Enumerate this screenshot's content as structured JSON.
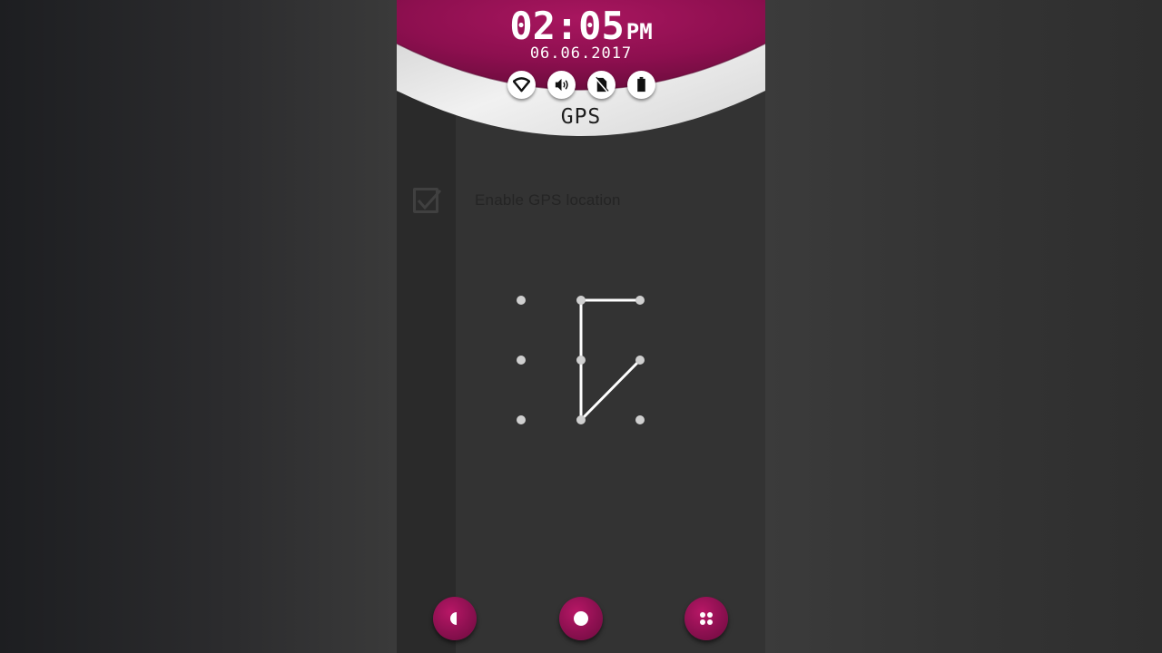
{
  "lockscreen": {
    "clock": {
      "time": "02:05",
      "ampm": "PM",
      "date": "06.06.2017"
    },
    "status_icons": [
      "wifi-icon",
      "volume-icon",
      "no-sim-icon",
      "battery-icon"
    ],
    "title": "GPS",
    "colors": {
      "accent": "#9c1258",
      "header_silver": "#e6e6e6",
      "background": "#333333"
    }
  },
  "settings": {
    "gps_option_label": "Enable GPS location",
    "gps_option_checked": true
  },
  "pattern": {
    "grid": "3x3",
    "path": [
      3,
      2,
      5,
      8,
      6
    ]
  },
  "navigation": {
    "buttons": [
      "back-icon",
      "home-icon",
      "apps-icon"
    ]
  }
}
